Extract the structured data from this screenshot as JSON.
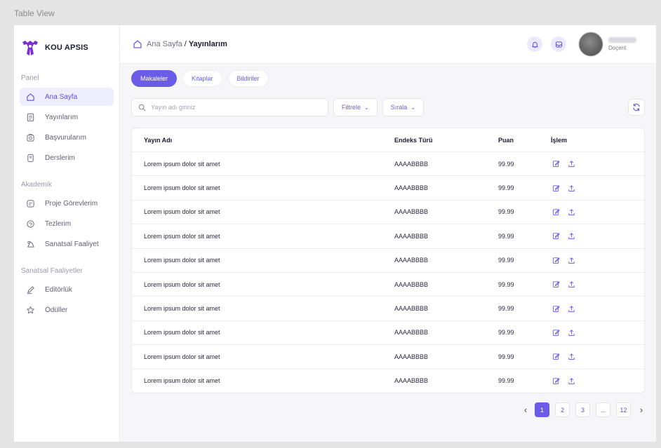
{
  "frame_label": "Table View",
  "brand": {
    "name": "KOU APSIS",
    "icon": "kou-logo-icon",
    "accent": "#7b2fd1"
  },
  "sidebar": {
    "sections": [
      {
        "title": "Panel",
        "items": [
          {
            "label": "Ana Sayfa",
            "icon": "home-icon",
            "active": true
          },
          {
            "label": "Yayınlarım",
            "icon": "document-icon"
          },
          {
            "label": "Başvurularım",
            "icon": "application-icon"
          },
          {
            "label": "Derslerim",
            "icon": "book-icon"
          }
        ]
      },
      {
        "title": "Akademik",
        "items": [
          {
            "label": "Proje Görevlerim",
            "icon": "task-icon"
          },
          {
            "label": "Tezlerim",
            "icon": "thesis-icon"
          },
          {
            "label": "Sanatsal Faaliyet",
            "icon": "art-icon"
          }
        ]
      },
      {
        "title": "Sanatsal Faaliyetler",
        "items": [
          {
            "label": "Editörlük",
            "icon": "pen-icon"
          },
          {
            "label": "Ödüller",
            "icon": "award-icon"
          }
        ]
      }
    ]
  },
  "breadcrumb": {
    "home": "Ana Sayfa",
    "separator": "/",
    "current": "Yayınlarım"
  },
  "user": {
    "role": "Doçent"
  },
  "tabs": [
    {
      "label": "Makaleler",
      "active": true
    },
    {
      "label": "Kitaplar"
    },
    {
      "label": "Bildiriler"
    }
  ],
  "search": {
    "placeholder": "Yayın adı giriniz",
    "value": ""
  },
  "filters": {
    "filter_label": "Filtrele",
    "sort_label": "Sırala"
  },
  "table": {
    "headers": [
      "Yayın Adı",
      "Endeks Türü",
      "Puan",
      "İşlem"
    ],
    "rows": [
      {
        "name": "Lorem ipsum dolor sit amet",
        "index": "AAAABBBB",
        "score": "99.99"
      },
      {
        "name": "Lorem ipsum dolor sit amet",
        "index": "AAAABBBB",
        "score": "99.99"
      },
      {
        "name": "Lorem ipsum dolor sit amet",
        "index": "AAAABBBB",
        "score": "99.99"
      },
      {
        "name": "Lorem ipsum dolor sit amet",
        "index": "AAAABBBB",
        "score": "99.99"
      },
      {
        "name": "Lorem ipsum dolor sit amet",
        "index": "AAAABBBB",
        "score": "99.99"
      },
      {
        "name": "Lorem ipsum dolor sit amet",
        "index": "AAAABBBB",
        "score": "99.99"
      },
      {
        "name": "Lorem ipsum dolor sit amet",
        "index": "AAAABBBB",
        "score": "99.99"
      },
      {
        "name": "Lorem ipsum dolor sit amet",
        "index": "AAAABBBB",
        "score": "99.99"
      },
      {
        "name": "Lorem ipsum dolor sit amet",
        "index": "AAAABBBB",
        "score": "99.99"
      },
      {
        "name": "Lorem ipsum dolor sit amet",
        "index": "AAAABBBB",
        "score": "99.99"
      }
    ]
  },
  "pagination": {
    "pages": [
      "1",
      "2",
      "3",
      "...",
      "12"
    ],
    "current": "1"
  },
  "colors": {
    "primary": "#6b5ce7",
    "active_bg": "#efeefe"
  }
}
